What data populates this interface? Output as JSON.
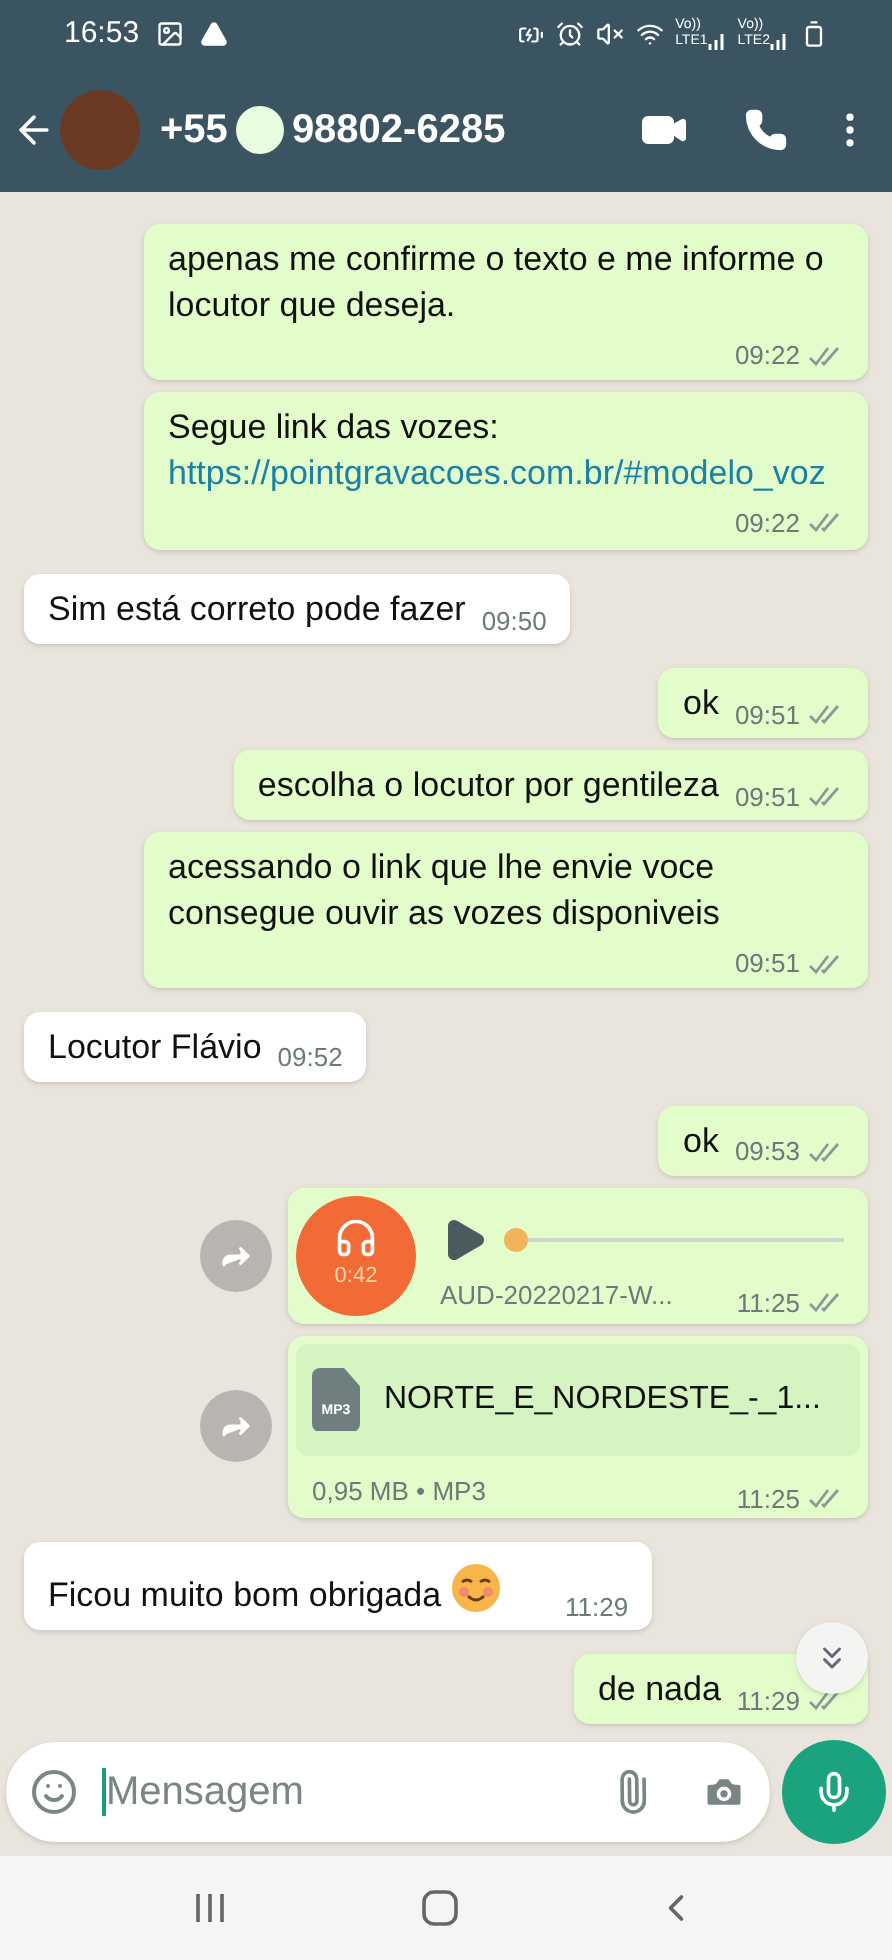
{
  "status_bar": {
    "time": "16:53",
    "sim_labels": [
      {
        "top": "Vo))",
        "bottom": "LTE1"
      },
      {
        "top": "Vo))",
        "bottom": "LTE2"
      }
    ]
  },
  "header": {
    "phone_prefix": "+55",
    "phone_number": "98802-6285"
  },
  "messages": [
    {
      "outgoing": true,
      "kind": "text",
      "text": "apenas me confirme o texto e me informe o locutor que deseja.",
      "time": "09:22"
    },
    {
      "outgoing": true,
      "kind": "link",
      "text": "Segue link das vozes:",
      "link": "https://pointgravacoes.com.br/#modelo_voz",
      "time": "09:22"
    },
    {
      "outgoing": false,
      "kind": "text",
      "text": "Sim está correto pode fazer",
      "time": "09:50"
    },
    {
      "outgoing": true,
      "kind": "text",
      "text": "ok",
      "time": "09:51"
    },
    {
      "outgoing": true,
      "kind": "text",
      "text": "escolha o locutor por gentileza",
      "time": "09:51"
    },
    {
      "outgoing": true,
      "kind": "text",
      "text": "acessando o link que lhe envie voce consegue ouvir as vozes disponiveis",
      "time": "09:51"
    },
    {
      "outgoing": false,
      "kind": "text",
      "text": "Locutor Flávio",
      "time": "09:52"
    },
    {
      "outgoing": true,
      "kind": "text",
      "text": "ok",
      "time": "09:53"
    },
    {
      "outgoing": true,
      "kind": "audio",
      "duration": "0:42",
      "file_name": "AUD-20220217-W...",
      "level": 0,
      "time": "11:25"
    },
    {
      "outgoing": true,
      "kind": "document",
      "file_type_badge": "MP3",
      "file_name": "NORTE_E_NORDESTE_-_1...",
      "info": "0,95 MB • MP3",
      "time": "11:25"
    },
    {
      "outgoing": false,
      "kind": "emoji_text",
      "text": "Ficou muito bom obrigada",
      "time": "11:29"
    },
    {
      "outgoing": true,
      "kind": "text",
      "text": "de nada",
      "time": "11:29"
    }
  ],
  "composer": {
    "placeholder": "Mensagem"
  }
}
